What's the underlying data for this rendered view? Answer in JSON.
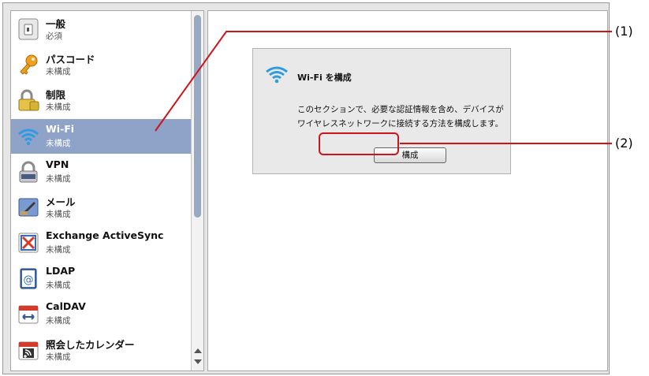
{
  "sidebar": {
    "items": [
      {
        "title": "一般",
        "subtitle": "必須",
        "icon": "general-icon",
        "selected": false
      },
      {
        "title": "パスコード",
        "subtitle": "未構成",
        "icon": "key-icon",
        "selected": false
      },
      {
        "title": "制限",
        "subtitle": "未構成",
        "icon": "lock-icon",
        "selected": false
      },
      {
        "title": "Wi-Fi",
        "subtitle": "未構成",
        "icon": "wifi-icon",
        "selected": true
      },
      {
        "title": "VPN",
        "subtitle": "未構成",
        "icon": "vpn-icon",
        "selected": false
      },
      {
        "title": "メール",
        "subtitle": "未構成",
        "icon": "mail-icon",
        "selected": false
      },
      {
        "title": "Exchange ActiveSync",
        "subtitle": "未構成",
        "icon": "exchange-icon",
        "selected": false
      },
      {
        "title": "LDAP",
        "subtitle": "未構成",
        "icon": "ldap-icon",
        "selected": false
      },
      {
        "title": "CalDAV",
        "subtitle": "未構成",
        "icon": "caldav-icon",
        "selected": false
      },
      {
        "title": "照会したカレンダー",
        "subtitle": "未構成",
        "icon": "subscribed-calendar-icon",
        "selected": false
      }
    ]
  },
  "config": {
    "title": "Wi-Fi を構成",
    "description": "このセクションで、必要な認証情報を含め、デバイスがワイヤレスネットワークに接続する方法を構成します。",
    "button_label": "構成"
  },
  "annotations": {
    "callout_1": "(1)",
    "callout_2": "(2)"
  },
  "colors": {
    "selection": "#8fa3c8",
    "annotation_red": "#d0121b",
    "wifi_blue": "#2f9be0"
  }
}
